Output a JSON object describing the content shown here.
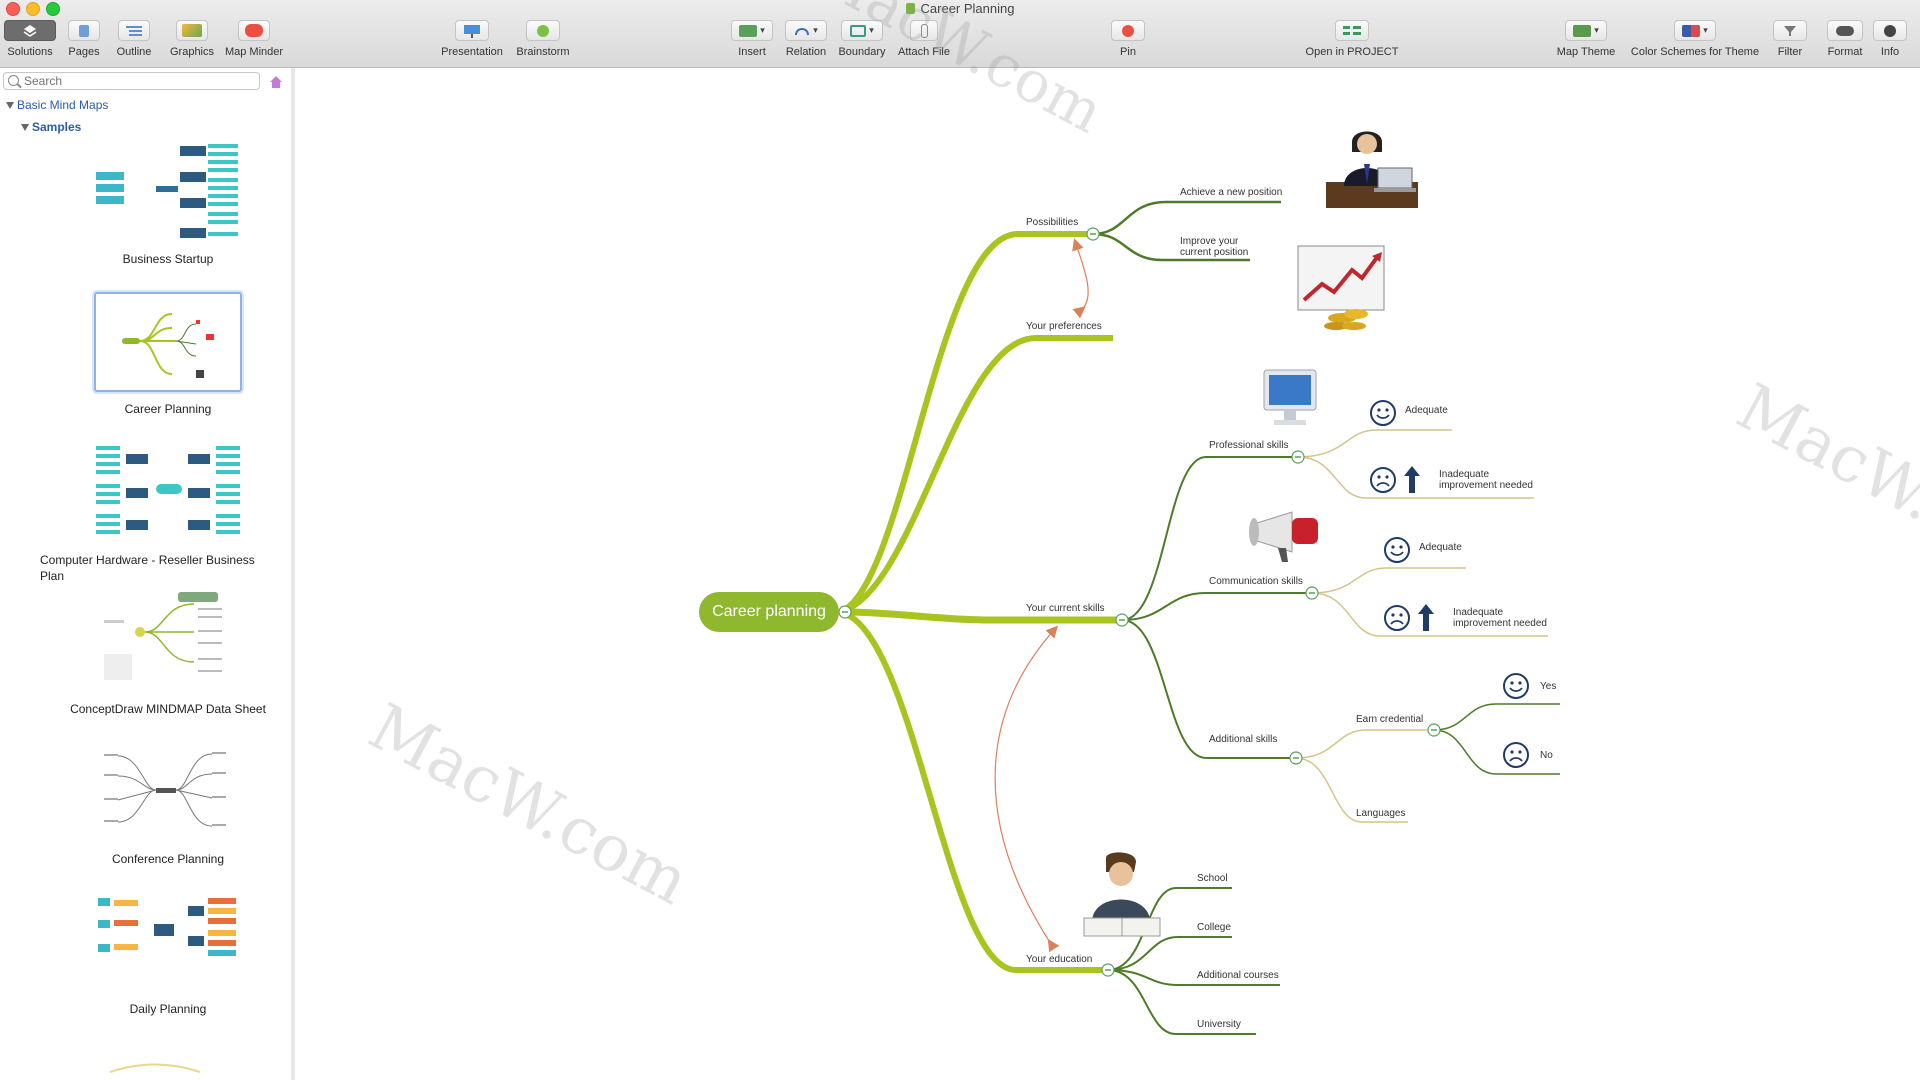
{
  "window": {
    "title": "Career Planning"
  },
  "toolbar": {
    "solutions": "Solutions",
    "pages": "Pages",
    "outline": "Outline",
    "graphics": "Graphics",
    "map_minder": "Map Minder",
    "presentation": "Presentation",
    "brainstorm": "Brainstorm",
    "insert": "Insert",
    "relation": "Relation",
    "boundary": "Boundary",
    "attach_file": "Attach File",
    "pin": "Pin",
    "open_in_project": "Open in PROJECT",
    "map_theme": "Map Theme",
    "color_schemes": "Color Schemes for Theme",
    "filter": "Filter",
    "format": "Format",
    "info": "Info"
  },
  "sidebar": {
    "search_placeholder": "Search",
    "tree_root": "Basic Mind Maps",
    "tree_child": "Samples",
    "templates": [
      "Business Startup",
      "Career Planning",
      "Computer Hardware - Reseller Business Plan",
      "ConceptDraw MINDMAP Data Sheet",
      "Conference Planning",
      "Daily Planning"
    ]
  },
  "mindmap": {
    "root": "Career planning",
    "possibilities": "Possibilities",
    "achieve": "Achieve a new position",
    "improve": "Improve your current position",
    "preferences": "Your preferences",
    "current_skills": "Your current skills",
    "professional": "Professional skills",
    "prof_adequate": "Adequate",
    "prof_inadequate": "Inadequate improvement needed",
    "communication": "Communication skills",
    "comm_adequate": "Adequate",
    "comm_inadequate": "Inadequate improvement needed",
    "additional": "Additional skills",
    "earn_credential": "Earn credential",
    "yes": "Yes",
    "no": "No",
    "languages": "Languages",
    "education": "Your education",
    "school": "School",
    "college": "College",
    "additional_courses": "Additional courses",
    "university": "University"
  },
  "watermark": "MacW.com",
  "colors": {
    "branch_main": "#a9c41f",
    "branch_sub": "#4f7a2a",
    "branch_leaf": "#d4c48a",
    "relation": "#d9805c",
    "root": "#8fb82e"
  }
}
